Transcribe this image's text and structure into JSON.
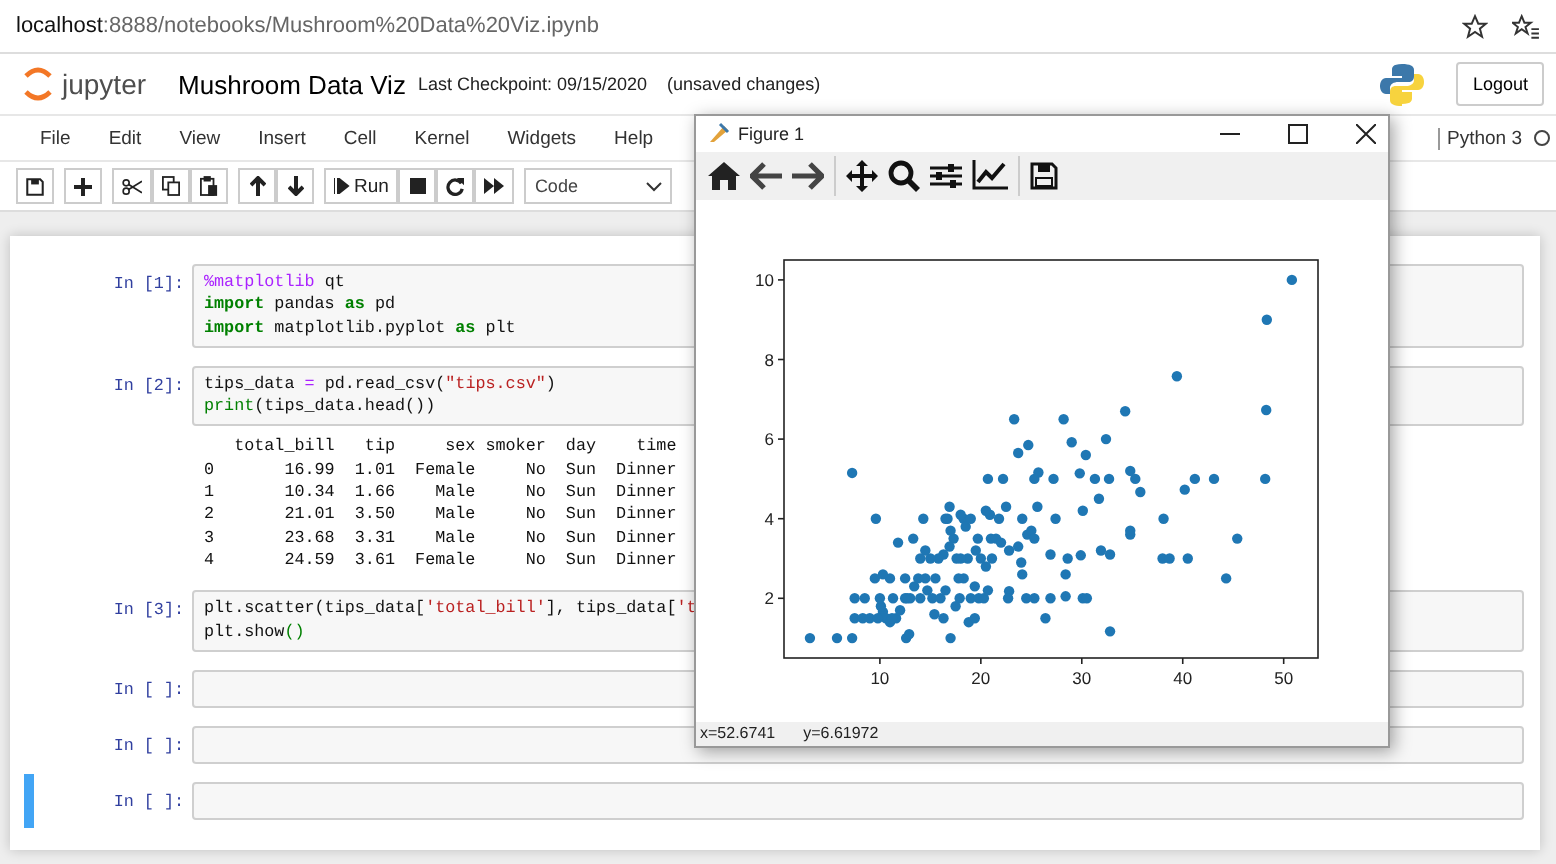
{
  "browser": {
    "url_host": "localhost",
    "url_path": ":8888/notebooks/Mushroom%20Data%20Viz.ipynb"
  },
  "header": {
    "logo": "jupyter",
    "title": "Mushroom Data Viz",
    "checkpoint": "Last Checkpoint: 09/15/2020",
    "status": "(unsaved changes)",
    "logout": "Logout"
  },
  "menu": [
    "File",
    "Edit",
    "View",
    "Insert",
    "Cell",
    "Kernel",
    "Widgets",
    "Help"
  ],
  "kernel": "Python 3",
  "toolbar": {
    "run": "Run",
    "cell_type": "Code"
  },
  "cells": [
    {
      "prompt": "In [1]:",
      "selected": false,
      "lines": [
        [
          {
            "t": "%matplotlib",
            "kind": "magic"
          },
          {
            "t": " qt",
            "kind": "plain"
          }
        ],
        [
          {
            "t": "import",
            "kind": "keyword"
          },
          {
            "t": " pandas ",
            "kind": "plain"
          },
          {
            "t": "as",
            "kind": "keyword"
          },
          {
            "t": " pd",
            "kind": "plain"
          }
        ],
        [
          {
            "t": "import",
            "kind": "keyword"
          },
          {
            "t": " matplotlib.pyplot ",
            "kind": "plain"
          },
          {
            "t": "as",
            "kind": "keyword"
          },
          {
            "t": " plt",
            "kind": "plain"
          }
        ]
      ]
    },
    {
      "prompt": "In [2]:",
      "selected": false,
      "lines": [
        [
          {
            "t": "tips_data ",
            "kind": "plain"
          },
          {
            "t": "=",
            "kind": "operator"
          },
          {
            "t": " pd.read_csv(",
            "kind": "plain"
          },
          {
            "t": "\"tips.csv\"",
            "kind": "string"
          },
          {
            "t": ")",
            "kind": "plain"
          }
        ],
        [
          {
            "t": "print",
            "kind": "builtin"
          },
          {
            "t": "(tips_data.head())",
            "kind": "plain"
          }
        ]
      ],
      "output": [
        "   total_bill   tip     sex smoker  day    time",
        "0       16.99  1.01  Female     No  Sun  Dinner",
        "1       10.34  1.66    Male     No  Sun  Dinner",
        "2       21.01  3.50    Male     No  Sun  Dinner",
        "3       23.68  3.31    Male     No  Sun  Dinner",
        "4       24.59  3.61  Female     No  Sun  Dinner"
      ]
    },
    {
      "prompt": "In [3]:",
      "selected": false,
      "lines": [
        [
          {
            "t": "plt.scatter(tips_data[",
            "kind": "plain"
          },
          {
            "t": "'total_bill'",
            "kind": "string"
          },
          {
            "t": "], tips_data[",
            "kind": "plain"
          },
          {
            "t": "'t",
            "kind": "string"
          }
        ],
        [
          {
            "t": "plt.show",
            "kind": "plain"
          },
          {
            "t": "()",
            "kind": "builtin"
          }
        ]
      ]
    },
    {
      "prompt": "In [ ]:",
      "selected": false
    },
    {
      "prompt": "In [ ]:",
      "selected": false
    },
    {
      "prompt": "In [ ]:",
      "selected": true
    }
  ],
  "figure": {
    "title": "Figure 1",
    "status_x": "x=52.6741",
    "status_y": "y=6.61972",
    "chart_data": {
      "type": "scatter",
      "xlim": [
        0.5,
        53.4
      ],
      "ylim": [
        0.5,
        10.5
      ],
      "xticks": [
        10,
        20,
        30,
        40,
        50
      ],
      "yticks": [
        2,
        4,
        6,
        8,
        10
      ],
      "x": [
        50.81,
        48.33,
        39.42,
        48.27,
        34.3,
        23.3,
        28.2,
        29,
        24.7,
        32.4,
        30.4,
        23.7,
        7.25,
        48.17,
        43.1,
        41.2,
        40.2,
        34.8,
        35.3,
        35.8,
        31.7,
        29.8,
        31.3,
        32.7,
        27.2,
        25.7,
        25.3,
        20.7,
        22.2,
        38.1,
        9.6,
        14.3,
        16.7,
        18.3,
        20.9,
        24.1,
        25.6,
        27.4,
        30.1,
        34.8,
        34.8,
        45.4,
        38,
        38.7,
        40.5,
        44.3,
        31.9,
        32.8,
        28.6,
        29.9,
        26.9,
        28.4,
        24,
        24.1,
        22.8,
        25.3,
        24.5,
        22.7,
        26.9,
        30.1,
        30.5,
        26.4,
        32.8,
        28.4,
        3.07,
        5.75,
        7.25,
        12.6,
        12.9,
        16.3,
        17,
        18.8,
        19.4,
        7.5,
        8.5,
        7.5,
        8.3,
        9,
        10.3,
        10.1,
        10.6,
        11,
        11.3,
        11.6,
        12,
        12.7,
        13,
        13.4,
        14,
        14.7,
        15.2,
        15.4,
        16,
        16.5,
        17.5,
        17.9,
        18.3,
        19,
        19.8,
        20.3,
        20.7,
        21,
        21.5,
        22,
        22.8,
        23.7,
        24.6,
        25,
        25.3,
        20,
        19.5,
        18.7,
        18,
        17.6,
        17.3,
        16.9,
        16.3,
        15.8,
        15,
        14.5,
        14,
        13.3,
        12.5,
        11.8,
        11,
        10.3,
        9.5,
        16.5,
        17,
        18.5,
        19,
        19.7,
        20.5,
        21.8,
        22.5,
        16.9,
        18,
        17.8,
        19.4,
        20.5,
        21.1,
        12.5,
        11.2,
        10,
        9.8,
        13.8,
        15.5,
        14.5
      ],
      "series": [
        {
          "color": "#1f77b4",
          "values": [
            10,
            9,
            7.58,
            6.73,
            6.7,
            6.5,
            6.5,
            5.92,
            5.85,
            6,
            5.6,
            5.65,
            5.15,
            5,
            5,
            5,
            4.73,
            5.2,
            5,
            4.67,
            4.5,
            5.14,
            5,
            5,
            5,
            5.16,
            5,
            5,
            5,
            4,
            4,
            4,
            4,
            4,
            4.1,
            4,
            4.3,
            4,
            4.2,
            3.6,
            3.7,
            3.5,
            3,
            3,
            3,
            2.5,
            3.2,
            3.1,
            3,
            3.08,
            3.1,
            2.6,
            2.9,
            2.6,
            2.18,
            2,
            2,
            2,
            2,
            2,
            2,
            1.5,
            1.17,
            2.05,
            1,
            1,
            1,
            1,
            1.1,
            1.5,
            1,
            1.4,
            1.5,
            2,
            2,
            1.5,
            1.5,
            1.5,
            1.66,
            1.8,
            1.5,
            1.4,
            2,
            1.5,
            1.7,
            2,
            2,
            2.3,
            2,
            2.2,
            2,
            1.6,
            2,
            2.2,
            1.8,
            2,
            2.5,
            2,
            2,
            2,
            2.2,
            3.5,
            3.5,
            3.4,
            3.2,
            3.3,
            3.6,
            3.7,
            3.5,
            3,
            3.2,
            3,
            3,
            3,
            3.5,
            3.3,
            3.1,
            3,
            3,
            3.2,
            3,
            3.5,
            2.5,
            3.4,
            2.5,
            2.6,
            2.5,
            4,
            3.7,
            3.8,
            4,
            3.5,
            4.2,
            4,
            4.3,
            4.3,
            4.1,
            2.5,
            2.3,
            2.8,
            3,
            2,
            1.5,
            2,
            1.5,
            2.5,
            2.5,
            2.5
          ]
        }
      ]
    }
  }
}
